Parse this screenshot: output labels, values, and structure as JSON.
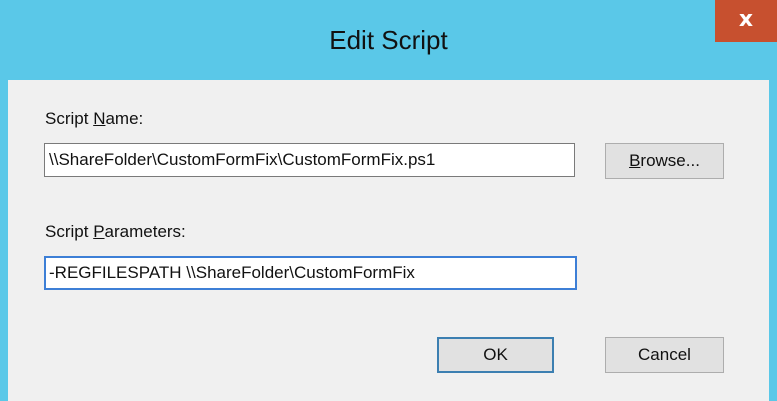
{
  "window": {
    "title": "Edit Script",
    "close_glyph": "x"
  },
  "form": {
    "script_name_label_prefix": "Script ",
    "script_name_label_accel": "N",
    "script_name_label_suffix": "ame:",
    "script_name_value": "\\\\ShareFolder\\CustomFormFix\\CustomFormFix.ps1",
    "script_params_label_prefix": "Script ",
    "script_params_label_accel": "P",
    "script_params_label_suffix": "arameters:",
    "script_params_value": "-REGFILESPATH \\\\ShareFolder\\CustomFormFix"
  },
  "buttons": {
    "browse_accel": "B",
    "browse_rest": "rowse...",
    "ok_label": "OK",
    "cancel_label": "Cancel"
  },
  "colors": {
    "titlebar": "#5ac8e8",
    "close_button": "#c7502f",
    "dialog_body": "#f0f0f0",
    "focus_border": "#3d7fd6"
  }
}
